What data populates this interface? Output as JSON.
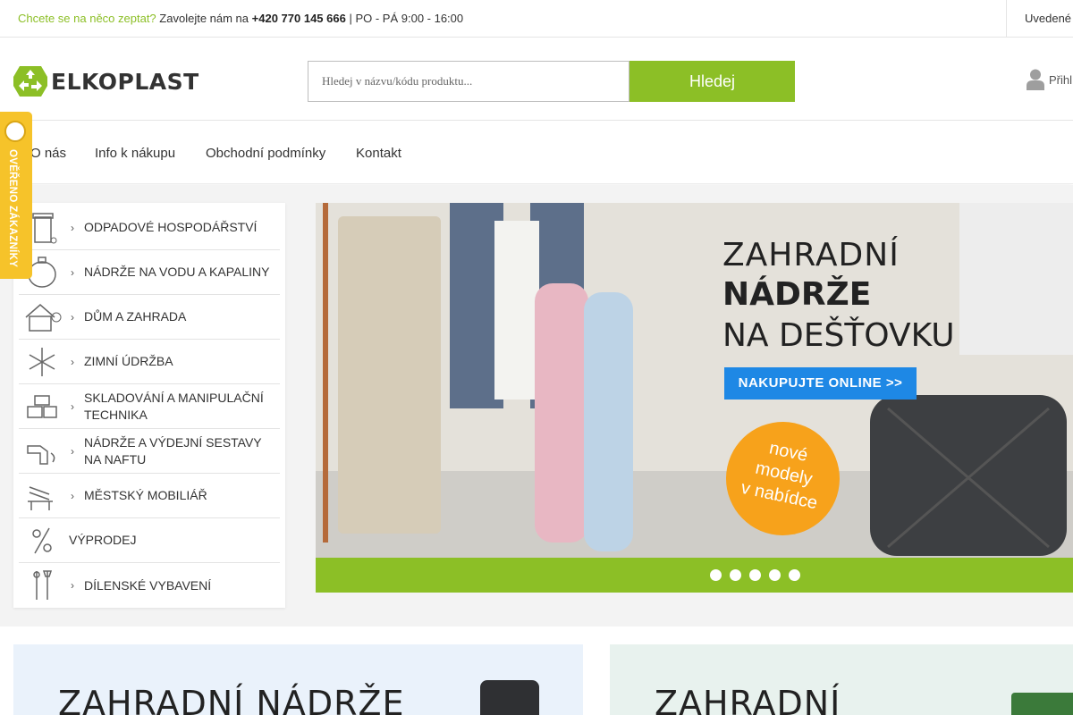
{
  "topbar": {
    "question": "Chcete se na něco zeptat?",
    "call": "Zavolejte nám na",
    "phone": "+420 770 145 666",
    "hours": "| PO - PÁ 9:00 - 16:00",
    "right": "Uvedené"
  },
  "header": {
    "logo_text": "ELKOPLAST",
    "search_placeholder": "Hledej v názvu/kódu produktu...",
    "search_button": "Hledej",
    "login": "Přihl"
  },
  "nav": [
    {
      "label": "O nás",
      "icon": "info"
    },
    {
      "label": "Info k nákupu"
    },
    {
      "label": "Obchodní podmínky"
    },
    {
      "label": "Kontakt"
    }
  ],
  "badge": {
    "text": "OVĚŘENO ZÁKAZNÍKY"
  },
  "categories": [
    {
      "label": "ODPADOVÉ HOSPODÁŘSTVÍ",
      "icon": "waste-bin-icon",
      "chevron": true
    },
    {
      "label": "NÁDRŽE NA VODU A KAPALINY",
      "icon": "water-tank-icon",
      "chevron": true
    },
    {
      "label": "DŮM A ZAHRADA",
      "icon": "house-garden-icon",
      "chevron": true
    },
    {
      "label": "ZIMNÍ ÚDRŽBA",
      "icon": "snowflake-icon",
      "chevron": true
    },
    {
      "label": "SKLADOVÁNÍ A MANIPULAČNÍ TECHNIKA",
      "icon": "storage-boxes-icon",
      "chevron": true
    },
    {
      "label": "NÁDRŽE A VÝDEJNÍ SESTAVY NA NAFTU",
      "icon": "fuel-nozzle-icon",
      "chevron": true
    },
    {
      "label": "MĚSTSKÝ MOBILIÁŘ",
      "icon": "bench-icon",
      "chevron": true
    },
    {
      "label": "VÝPRODEJ",
      "icon": "percent-icon",
      "chevron": false
    },
    {
      "label": "DÍLENSKÉ VYBAVENÍ",
      "icon": "tools-icon",
      "chevron": true
    }
  ],
  "banner": {
    "line1": "ZAHRADNÍ",
    "line2": "NÁDRŽE",
    "line3": "NA DEŠŤOVKU",
    "cta": "NAKUPUJTE ONLINE >>",
    "sticker_l1": "nové",
    "sticker_l2": "modely",
    "sticker_l3": "v nabídce",
    "slides": 5,
    "active_slide": 1
  },
  "promos": [
    {
      "title": "ZAHRADNÍ NÁDRŽE"
    },
    {
      "title": "ZAHRADNÍ"
    }
  ],
  "colors": {
    "accent_green": "#8cbf26",
    "cta_blue": "#1e88e5",
    "sticker_orange": "#f7a21b",
    "badge_yellow": "#f6c32a"
  }
}
